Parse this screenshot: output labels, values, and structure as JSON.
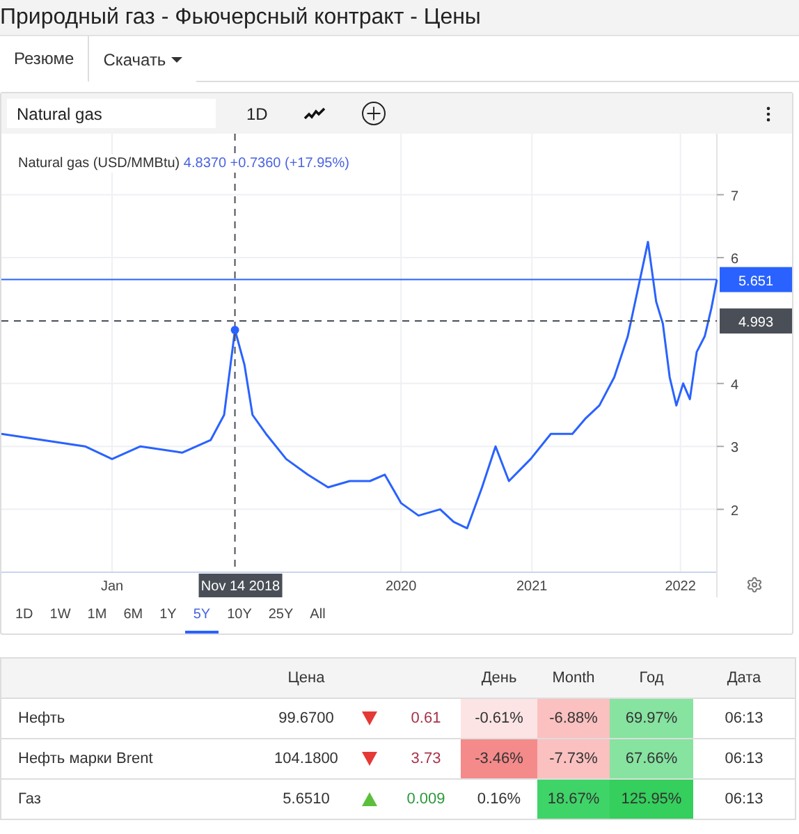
{
  "window": {
    "title": "Природный газ - Фьючерсный контракт - Цены"
  },
  "tabs": [
    {
      "label": "Резюме",
      "selected": true,
      "dropdown": false
    },
    {
      "label": "Скачать",
      "selected": false,
      "dropdown": true
    }
  ],
  "toolbar": {
    "search_value": "Natural gas",
    "interval": "1D"
  },
  "legend": {
    "price": "4.8370",
    "change": "+0.7360 (+17.95%)"
  },
  "chart_data": {
    "type": "line",
    "grid": true,
    "xlim": [
      2017.1,
      2022.4
    ],
    "ylim": [
      1.0,
      7.97
    ],
    "xticks": [
      {
        "value": 2017.92,
        "label": "Jan"
      },
      {
        "value": 2020.06,
        "label": "2020"
      },
      {
        "value": 2021.03,
        "label": "2021"
      },
      {
        "value": 2022.13,
        "label": "2022"
      }
    ],
    "yticks": [
      2,
      3,
      4,
      6,
      7
    ],
    "x": [
      2017.1,
      2017.41,
      2017.72,
      2017.92,
      2018.13,
      2018.44,
      2018.65,
      2018.75,
      2018.83,
      2018.9,
      2018.96,
      2019.06,
      2019.21,
      2019.37,
      2019.52,
      2019.68,
      2019.83,
      2019.94,
      2020.06,
      2020.19,
      2020.35,
      2020.45,
      2020.55,
      2020.66,
      2020.76,
      2020.86,
      2021.02,
      2021.17,
      2021.33,
      2021.43,
      2021.53,
      2021.64,
      2021.74,
      2021.84,
      2021.89,
      2021.95,
      2022.0,
      2022.05,
      2022.1,
      2022.15,
      2022.2,
      2022.25,
      2022.31,
      2022.36,
      2022.4
    ],
    "series": [
      {
        "name": "Natural gas (USD/MMBtu)",
        "color": "#2962ff",
        "values": [
          3.2,
          3.1,
          3.0,
          2.8,
          3.0,
          2.9,
          3.1,
          3.5,
          4.85,
          4.3,
          3.5,
          3.2,
          2.8,
          2.55,
          2.35,
          2.45,
          2.45,
          2.55,
          2.1,
          1.9,
          2.0,
          1.8,
          1.7,
          2.35,
          3.0,
          2.45,
          2.8,
          3.2,
          3.2,
          3.45,
          3.65,
          4.1,
          4.75,
          5.75,
          6.25,
          5.3,
          4.95,
          4.1,
          3.65,
          4.0,
          3.75,
          4.5,
          4.75,
          5.2,
          5.65
        ]
      }
    ],
    "ref_lines": [
      {
        "axis": "y",
        "value": 5.651,
        "label": "5.651",
        "color": "#2962ff"
      },
      {
        "axis": "y",
        "value": 4.993,
        "label": "4.993",
        "color": "#4a4f57"
      },
      {
        "axis": "x",
        "value": 2018.83,
        "label": "Nov 14 2018",
        "color": "#4a4f57"
      }
    ]
  },
  "ranges": [
    {
      "label": "1D",
      "selected": false
    },
    {
      "label": "1W",
      "selected": false
    },
    {
      "label": "1M",
      "selected": false
    },
    {
      "label": "6M",
      "selected": false
    },
    {
      "label": "1Y",
      "selected": false
    },
    {
      "label": "5Y",
      "selected": true
    },
    {
      "label": "10Y",
      "selected": false
    },
    {
      "label": "25Y",
      "selected": false
    },
    {
      "label": "All",
      "selected": false
    }
  ],
  "table": {
    "columns": [
      "Цена",
      "День",
      "Month",
      "Год",
      "Дата"
    ],
    "rows": [
      {
        "name": "Нефть",
        "price": "99.6700",
        "kind": "down",
        "change": "0.61",
        "day": {
          "text": "-0.61%",
          "color": "#fde4e4"
        },
        "month": {
          "text": "-6.88%",
          "color": "#fbc0c0"
        },
        "year": {
          "text": "69.97%",
          "color": "#86e3a0"
        },
        "time": "06:13"
      },
      {
        "name": "Нефть марки Brent",
        "price": "104.1800",
        "kind": "down",
        "change": "3.73",
        "day": {
          "text": "-3.46%",
          "color": "#f58a8a"
        },
        "month": {
          "text": "-7.73%",
          "color": "#fbc0c0"
        },
        "year": {
          "text": "67.66%",
          "color": "#86e3a0"
        },
        "time": "06:13"
      },
      {
        "name": "Газ",
        "price": "5.6510",
        "kind": "up",
        "change": "0.009",
        "day": {
          "text": "0.16%",
          "color": "#ffffff"
        },
        "month": {
          "text": "18.67%",
          "color": "#3fd468"
        },
        "year": {
          "text": "125.95%",
          "color": "#34cf5c"
        },
        "time": "06:13"
      }
    ]
  }
}
